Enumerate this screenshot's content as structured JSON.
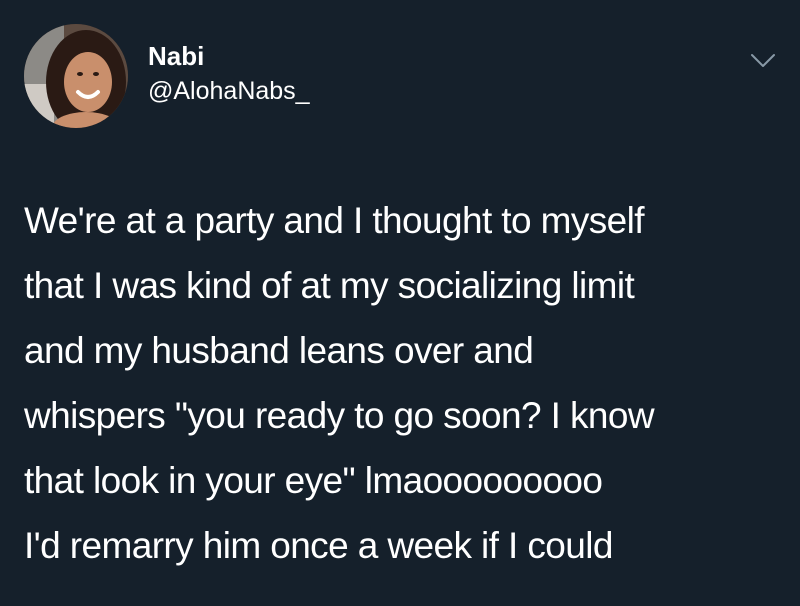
{
  "user": {
    "display_name": "Nabi",
    "handle": "@AlohaNabs_",
    "avatar_icon": "profile-photo"
  },
  "menu": {
    "icon": "chevron-down-icon"
  },
  "tweet": {
    "lines": [
      "We're at a party and I thought to myself",
      "that I was kind of at my socializing limit",
      "and my husband leans over and",
      "whispers \"you ready to go soon? I know",
      "that look in your eye\" lmaooooooooo",
      "I'd remarry him once a week if I could"
    ]
  },
  "colors": {
    "background": "#15202b",
    "text": "#ffffff",
    "caret": "#8899a6"
  }
}
